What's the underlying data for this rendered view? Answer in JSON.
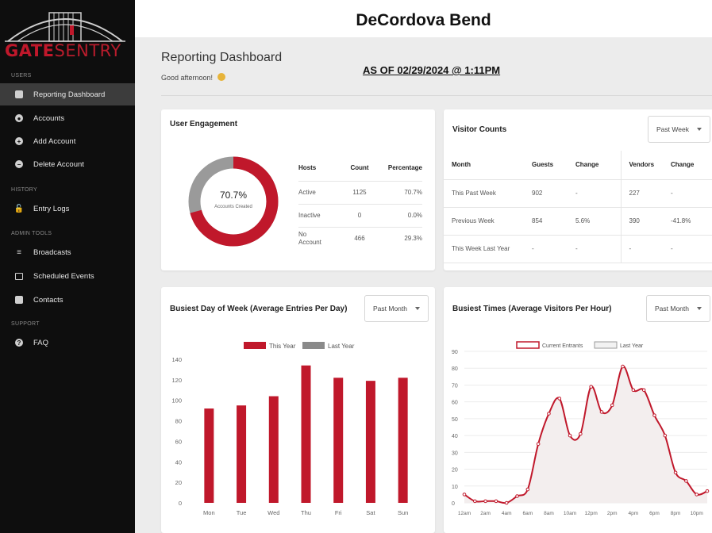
{
  "brand": {
    "word1": "GATE",
    "word2": "SENTRY"
  },
  "sidebar": {
    "sections": [
      {
        "label": "USERS"
      },
      {
        "label": "HISTORY"
      },
      {
        "label": "ADMIN TOOLS"
      },
      {
        "label": "SUPPORT"
      }
    ],
    "items": [
      {
        "label": "Reporting Dashboard",
        "icon": "dashboard-icon"
      },
      {
        "label": "Accounts",
        "icon": "user-icon"
      },
      {
        "label": "Add Account",
        "icon": "add-circle-icon"
      },
      {
        "label": "Delete Account",
        "icon": "remove-circle-icon"
      },
      {
        "label": "Entry Logs",
        "icon": "lock-icon"
      },
      {
        "label": "Broadcasts",
        "icon": "megaphone-icon"
      },
      {
        "label": "Scheduled Events",
        "icon": "calendar-icon"
      },
      {
        "label": "Contacts",
        "icon": "contacts-icon"
      },
      {
        "label": "FAQ",
        "icon": "help-icon"
      }
    ]
  },
  "header": {
    "community": "DeCordova Bend",
    "page_title": "Reporting Dashboard",
    "greeting": "Good afternoon!",
    "as_of": "AS OF 02/29/2024 @ 1:11PM"
  },
  "engagement": {
    "title": "User Engagement",
    "donut_value": "70.7%",
    "donut_label": "Accounts Created",
    "donut_fraction": 0.707,
    "columns": [
      "Hosts",
      "Count",
      "Percentage"
    ],
    "rows": [
      [
        "Active",
        "1125",
        "70.7%"
      ],
      [
        "Inactive",
        "0",
        "0.0%"
      ],
      [
        "No Account",
        "466",
        "29.3%"
      ]
    ]
  },
  "visitors": {
    "title": "Visitor Counts",
    "dropdown": "Past Week",
    "columns": [
      "Month",
      "Guests",
      "Change",
      "Vendors",
      "Change"
    ],
    "rows": [
      [
        "This Past Week",
        "902",
        "-",
        "227",
        "-"
      ],
      [
        "Previous Week",
        "854",
        "5.6%",
        "390",
        "-41.8%"
      ],
      [
        "This Week Last Year",
        "-",
        "-",
        "-",
        "-"
      ]
    ]
  },
  "busiest_day": {
    "title": "Busiest Day of Week (Average Entries Per Day)",
    "dropdown": "Past Month"
  },
  "busiest_times": {
    "title": "Busiest Times (Average Visitors Per Hour)",
    "dropdown": "Past Month"
  },
  "colors": {
    "accent": "#c0182b",
    "gray": "#8a8a8a",
    "sidebar_bg": "#0e0e0e"
  },
  "chart_data": [
    {
      "type": "bar",
      "legend": [
        "This Year",
        "Last Year"
      ],
      "categories": [
        "Mon",
        "Tue",
        "Wed",
        "Thu",
        "Fri",
        "Sat",
        "Sun"
      ],
      "series": [
        {
          "name": "This Year",
          "values": [
            92,
            95,
            104,
            134,
            122,
            119,
            122
          ],
          "color": "#c0182b"
        },
        {
          "name": "Last Year",
          "values": [],
          "color": "#8a8a8a"
        }
      ],
      "ylim": [
        0,
        140
      ],
      "yticks": [
        0,
        20,
        40,
        60,
        80,
        100,
        120,
        140
      ],
      "grid": false,
      "legend_position": "top-center"
    },
    {
      "type": "line",
      "legend": [
        "Current Entrants",
        "Last Year"
      ],
      "x": [
        "12am",
        "1am",
        "2am",
        "3am",
        "4am",
        "5am",
        "6am",
        "7am",
        "8am",
        "9am",
        "10am",
        "11am",
        "12pm",
        "1pm",
        "2pm",
        "3pm",
        "4pm",
        "5pm",
        "6pm",
        "7pm",
        "8pm",
        "9pm",
        "10pm",
        "11pm"
      ],
      "xticks": [
        "12am",
        "2am",
        "4am",
        "6am",
        "8am",
        "10am",
        "12pm",
        "2pm",
        "4pm",
        "6pm",
        "8pm",
        "10pm"
      ],
      "series": [
        {
          "name": "Current Entrants",
          "values": [
            5,
            1,
            1,
            1,
            0,
            4,
            8,
            35,
            53,
            62,
            40,
            41,
            69,
            54,
            58,
            81,
            67,
            67,
            52,
            40,
            18,
            13,
            5,
            7
          ],
          "color": "#c0182b"
        },
        {
          "name": "Last Year",
          "values": [],
          "color": "#c8c8c8"
        }
      ],
      "ylim": [
        0,
        90
      ],
      "yticks": [
        0,
        10,
        20,
        30,
        40,
        50,
        60,
        70,
        80,
        90
      ],
      "grid": true,
      "legend_position": "top-center"
    }
  ]
}
